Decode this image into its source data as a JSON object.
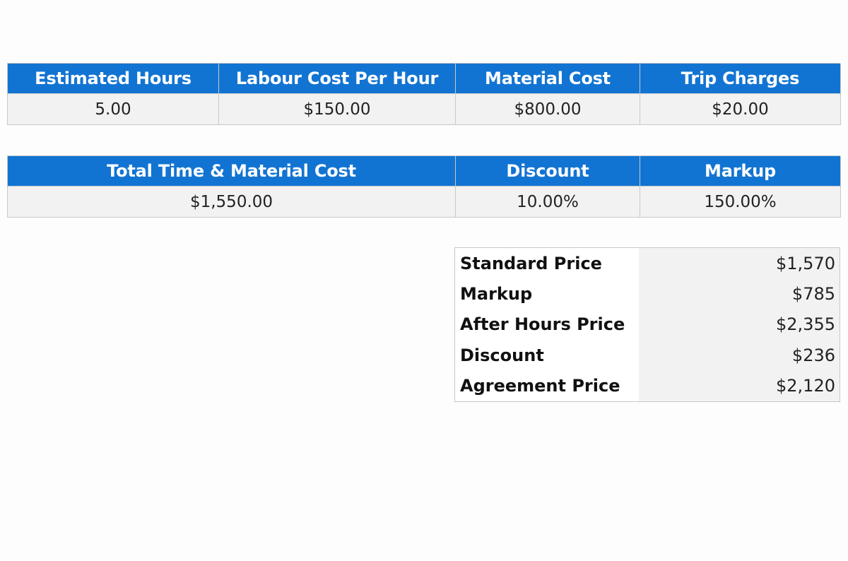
{
  "inputs_table": {
    "headers": [
      "Estimated Hours",
      "Labour Cost Per Hour",
      "Material Cost",
      "Trip Charges"
    ],
    "values": [
      "5.00",
      "$150.00",
      "$800.00",
      "$20.00"
    ]
  },
  "totals_table": {
    "headers": [
      "Total Time & Material Cost",
      "Discount",
      "Markup"
    ],
    "values": [
      "$1,550.00",
      "10.00%",
      "150.00%"
    ]
  },
  "summary_table": {
    "rows": [
      {
        "label": "Standard Price",
        "value": "$1,570"
      },
      {
        "label": "Markup",
        "value": "$785"
      },
      {
        "label": "After Hours Price",
        "value": "$2,355"
      },
      {
        "label": "Discount",
        "value": "$236"
      },
      {
        "label": "Agreement Price",
        "value": "$2,120"
      }
    ]
  },
  "colors": {
    "header_bg": "#1274d2",
    "header_text": "#ffffff",
    "cell_bg": "#f2f2f2",
    "border": "#c8c8c8"
  }
}
